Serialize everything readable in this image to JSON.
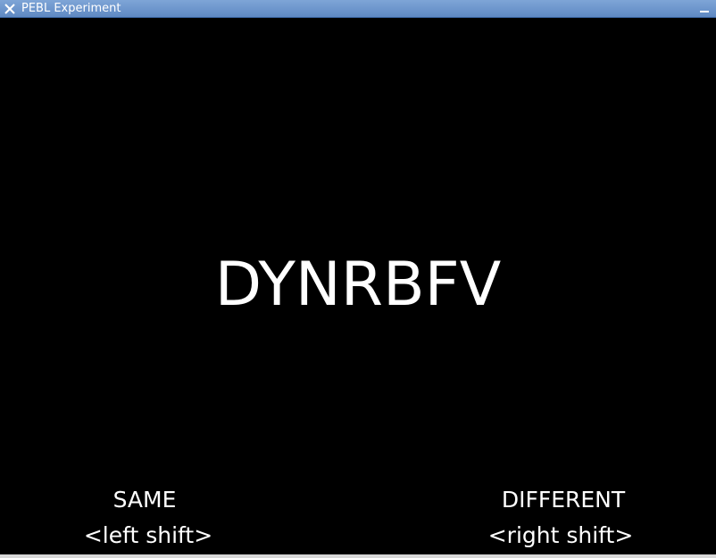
{
  "window": {
    "title": "PEBL Experiment"
  },
  "stimulus": {
    "letters": "DYNRBFV"
  },
  "responses": {
    "left": {
      "label": "SAME",
      "key": "<left shift>"
    },
    "right": {
      "label": "DIFFERENT",
      "key": "<right shift>"
    }
  },
  "colors": {
    "background": "#000000",
    "text": "#ffffff",
    "titlebar": "#6d95cc"
  },
  "icons": {
    "close": "close-icon",
    "minimize": "minimize-icon"
  }
}
